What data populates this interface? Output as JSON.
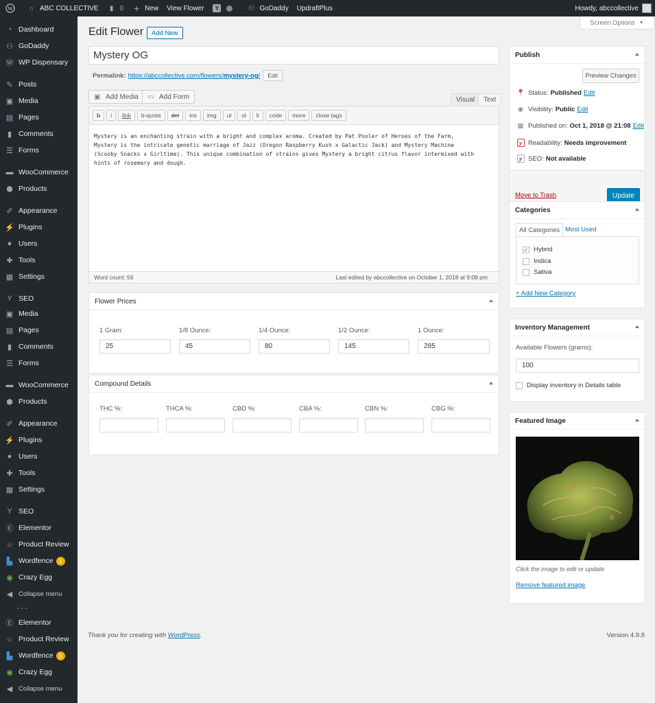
{
  "adminbar": {
    "site_name": "ABC COLLECTIVE",
    "comments_count": "0",
    "new_label": "New",
    "view_label": "View Flower",
    "godaddy_label": "GoDaddy",
    "updraft_label": "UpdraftPlus",
    "howdy": "Howdy, abccollective"
  },
  "sidebar": {
    "items": [
      {
        "label": "Dashboard",
        "icon": "dashboard-icon"
      },
      {
        "label": "GoDaddy",
        "icon": "godaddy-icon"
      },
      {
        "label": "WP Dispensary",
        "icon": "wp-dispensary-icon"
      },
      {
        "label": "Posts",
        "icon": "pin-icon"
      },
      {
        "label": "Media",
        "icon": "media-icon"
      },
      {
        "label": "Pages",
        "icon": "pages-icon"
      },
      {
        "label": "Comments",
        "icon": "comments-icon"
      },
      {
        "label": "Forms",
        "icon": "forms-icon"
      },
      {
        "label": "WooCommerce",
        "icon": "woocommerce-icon"
      },
      {
        "label": "Products",
        "icon": "products-icon"
      },
      {
        "label": "Appearance",
        "icon": "appearance-icon"
      },
      {
        "label": "Plugins",
        "icon": "plugins-icon"
      },
      {
        "label": "Users",
        "icon": "users-icon"
      },
      {
        "label": "Tools",
        "icon": "tools-icon"
      },
      {
        "label": "Settings",
        "icon": "settings-icon"
      },
      {
        "label": "SEO",
        "icon": "yoast-icon"
      },
      {
        "label": "Media",
        "icon": "media-icon"
      },
      {
        "label": "Pages",
        "icon": "pages-icon"
      },
      {
        "label": "Comments",
        "icon": "comments-icon"
      },
      {
        "label": "Forms",
        "icon": "forms-icon"
      },
      {
        "label": "WooCommerce",
        "icon": "woocommerce-icon"
      },
      {
        "label": "Products",
        "icon": "products-icon"
      },
      {
        "label": "Appearance",
        "icon": "appearance-icon"
      },
      {
        "label": "Plugins",
        "icon": "plugins-icon"
      },
      {
        "label": "Users",
        "icon": "users-icon"
      },
      {
        "label": "Tools",
        "icon": "tools-icon"
      },
      {
        "label": "Settings",
        "icon": "settings-icon"
      },
      {
        "label": "SEO",
        "icon": "yoast-icon"
      },
      {
        "label": "Elementor",
        "icon": "elementor-icon"
      },
      {
        "label": "Product Review",
        "icon": "star-icon"
      },
      {
        "label": "Wordfence",
        "icon": "wordfence-icon",
        "badge": "1"
      },
      {
        "label": "Crazy Egg",
        "icon": "crazy-egg-icon"
      },
      {
        "label": "Collapse menu",
        "icon": "collapse-icon"
      },
      {
        "label": "Elementor",
        "icon": "elementor-icon"
      },
      {
        "label": "Product Review",
        "icon": "star-icon"
      },
      {
        "label": "Wordfence",
        "icon": "wordfence-icon",
        "badge": "1"
      },
      {
        "label": "Crazy Egg",
        "icon": "crazy-egg-icon"
      },
      {
        "label": "Collapse menu",
        "icon": "collapse-icon"
      }
    ],
    "dashes": "- - -"
  },
  "header": {
    "screen_options": "Screen Options",
    "title": "Edit Flower",
    "add_new": "Add New"
  },
  "post": {
    "title": "Mystery OG",
    "permalink_label": "Permalink:",
    "permalink_base": "https://abccollective.com/flowers/",
    "permalink_slug": "mystery-og",
    "permalink_trail": "/",
    "edit_label": "Edit",
    "add_media": "Add Media",
    "add_form": "Add Form",
    "tab_visual": "Visual",
    "tab_text": "Text",
    "quicktags": [
      "b",
      "i",
      "link",
      "b-quote",
      "del",
      "ins",
      "img",
      "ul",
      "ol",
      "li",
      "code",
      "more",
      "close tags"
    ],
    "body": "Mystery is an enchanting strain with a bright and complex aroma. Created by Pat Pooler of Heroes of the Farm,\nMystery is the intricate genetic marriage of Jazz (Oregon Raspberry Kush x Galactic Jack) and Mystery Machine\n(Scooby Snacks x Girltime). This unique combination of strains gives Mystery a bright citrus flavor intermixed with\nhints of rosemary and dough.",
    "word_count": "Word count: 59",
    "last_edited": "Last edited by abccollective on October 1, 2018 at 9:08 pm"
  },
  "flower_prices": {
    "title": "Flower Prices",
    "fields": [
      {
        "label": "1 Gram:",
        "value": "25"
      },
      {
        "label": "1/8 Ounce:",
        "value": "45"
      },
      {
        "label": "1/4 Ounce:",
        "value": "80"
      },
      {
        "label": "1/2 Ounce:",
        "value": "145"
      },
      {
        "label": "1 Ounce:",
        "value": "285"
      }
    ]
  },
  "compound_details": {
    "title": "Compound Details",
    "fields": [
      {
        "label": "THC %:",
        "value": ""
      },
      {
        "label": "THCA %:",
        "value": ""
      },
      {
        "label": "CBD %:",
        "value": ""
      },
      {
        "label": "CBA %:",
        "value": ""
      },
      {
        "label": "CBN %:",
        "value": ""
      },
      {
        "label": "CBG %:",
        "value": ""
      }
    ]
  },
  "publish": {
    "title": "Publish",
    "preview": "Preview Changes",
    "status_label": "Status:",
    "status_value": "Published",
    "visibility_label": "Visibility:",
    "visibility_value": "Public",
    "published_label": "Published on:",
    "published_value": "Oct 1, 2018 @ 21:08",
    "edit": "Edit",
    "readability_label": "Readability:",
    "readability_value": "Needs improvement",
    "seo_label": "SEO:",
    "seo_value": "Not available",
    "trash": "Move to Trash",
    "update": "Update"
  },
  "categories": {
    "title": "Categories",
    "tab_all": "All Categories",
    "tab_used": "Most Used",
    "items": [
      {
        "label": "Hybrid",
        "checked": true
      },
      {
        "label": "Indica",
        "checked": false
      },
      {
        "label": "Sativa",
        "checked": false
      }
    ],
    "add_new": "+ Add New Category"
  },
  "inventory": {
    "title": "Inventory Management",
    "available_label": "Available Flowers (grams):",
    "available_value": "100",
    "display_label": "Display inventory in Details table"
  },
  "featured": {
    "title": "Featured Image",
    "hint": "Click the image to edit or update",
    "remove": "Remove featured image"
  },
  "footer": {
    "thanks_prefix": "Thank you for creating with ",
    "thanks_link": "WordPress",
    "thanks_suffix": ".",
    "version": "Version 4.9.8"
  },
  "colors": {
    "accent": "#0073aa",
    "primary_button": "#0085ba",
    "trash": "#a00",
    "sidebar": "#23282d"
  }
}
